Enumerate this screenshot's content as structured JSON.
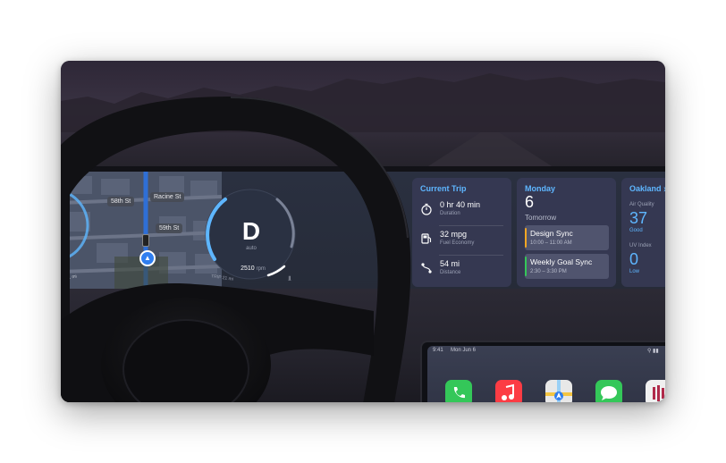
{
  "map": {
    "streets": [
      "58th St",
      "Racine St",
      "59th St"
    ],
    "footer_text": "TAL 11 mi"
  },
  "cluster": {
    "gear": "D",
    "gear_sub": "auto",
    "rpm_value": "2510",
    "rpm_unit": "rpm",
    "left_label": "TRIP 21 mi"
  },
  "trip": {
    "title": "Current Trip",
    "rows": [
      {
        "icon": "timer-icon",
        "value": "0 hr 40 min",
        "label": "Duration"
      },
      {
        "icon": "fuel-icon",
        "value": "32 mpg",
        "label": "Fuel Economy"
      },
      {
        "icon": "route-icon",
        "value": "54 mi",
        "label": "Distance"
      }
    ]
  },
  "calendar": {
    "day": "Monday",
    "date": "6",
    "tomorrow": "Tomorrow",
    "events": [
      {
        "title": "Design Sync",
        "time": "10:00 – 11:00 AM",
        "color": "#f5a623"
      },
      {
        "title": "Weekly Goal Sync",
        "time": "2:30 – 3:30 PM",
        "color": "#34c759"
      }
    ]
  },
  "weather": {
    "city": "Oakland",
    "aq_label": "Air Quality",
    "aq_value": "37",
    "aq_status": "Good",
    "uv_label": "UV Index",
    "uv_value": "0",
    "uv_status": "Low"
  },
  "carplay": {
    "status_time": "9:41",
    "status_date": "Mon Jun 6",
    "apps": [
      {
        "icon": "phone-icon",
        "color": "#34c759"
      },
      {
        "icon": "music-icon",
        "color": "#fc3c44"
      },
      {
        "icon": "maps-icon",
        "color": "#e8e8e8"
      },
      {
        "icon": "messages-icon",
        "color": "#34c759"
      },
      {
        "icon": "podcasts-icon",
        "color": "#f0f0f0"
      }
    ]
  },
  "colors": {
    "accent": "#5eb6ff",
    "widget_bg": "#363a54"
  }
}
